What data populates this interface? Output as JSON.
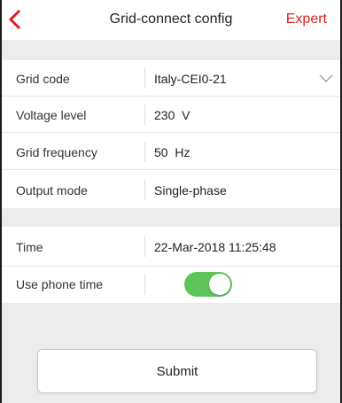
{
  "header": {
    "title": "Grid-connect config",
    "expert_label": "Expert",
    "back_icon": "chevron-left-icon"
  },
  "settings": {
    "grid_code": {
      "label": "Grid code",
      "value": "Italy-CEI0-21",
      "icon": "chevron-down-icon"
    },
    "voltage_level": {
      "label": "Voltage level",
      "value": "230  V"
    },
    "grid_frequency": {
      "label": "Grid frequency",
      "value": "50  Hz"
    },
    "output_mode": {
      "label": "Output mode",
      "value": "Single-phase"
    }
  },
  "time_settings": {
    "time": {
      "label": "Time",
      "value": "22-Mar-2018 11:25:48"
    },
    "use_phone_time": {
      "label": "Use phone time",
      "enabled": true
    }
  },
  "submit_label": "Submit",
  "colors": {
    "accent": "#e02020",
    "toggle_on": "#5dc55a",
    "section_gap": "#ececec"
  }
}
